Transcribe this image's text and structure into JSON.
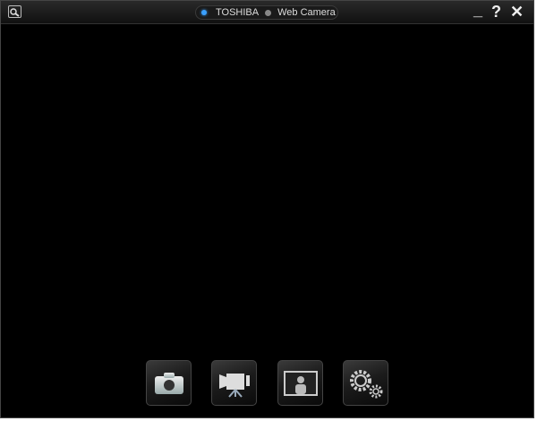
{
  "titlebar": {
    "brand": "TOSHIBA",
    "app_name": "Web Camera",
    "minimize": "_",
    "help": "?",
    "close": "✕"
  },
  "toolbar": {
    "buttons": [
      {
        "name": "capture-photo-button",
        "icon": "camera-icon"
      },
      {
        "name": "record-video-button",
        "icon": "video-camera-icon"
      },
      {
        "name": "gallery-button",
        "icon": "picture-frame-icon"
      },
      {
        "name": "settings-button",
        "icon": "gears-icon"
      }
    ]
  }
}
